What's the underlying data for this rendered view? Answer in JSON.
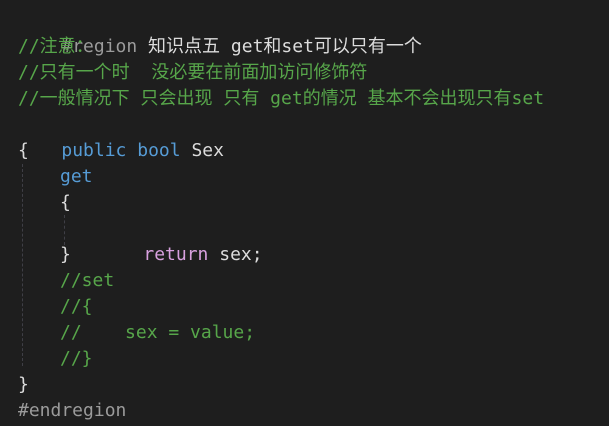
{
  "code": {
    "region": {
      "directive": "#region",
      "label": " 知识点五 get和set可以只有一个"
    },
    "comment_1": "//注意：",
    "comment_2": "//只有一个时  没必要在前面加访问修饰符",
    "comment_3": "//一般情况下 只会出现 只有 get的情况 基本不会出现只有set",
    "property": {
      "modifier": "public",
      "type": "bool",
      "name": "Sex"
    },
    "open_brace": "{",
    "getter_keyword": "get",
    "getter_open": "{",
    "return_keyword": "return",
    "return_expr": " sex;",
    "getter_close": "}",
    "setter_comment_1": "//set",
    "setter_comment_2": "//{",
    "setter_comment_3": "//    sex = value;",
    "setter_comment_4": "//}",
    "close_brace": "}",
    "endregion": "#endregion"
  },
  "colors": {
    "background": "#1e1e1e",
    "comment": "#57a64a",
    "keyword": "#569cd6",
    "control_keyword": "#d8a0df",
    "preprocessor": "#9b9b9b",
    "text": "#dcdcdc"
  }
}
